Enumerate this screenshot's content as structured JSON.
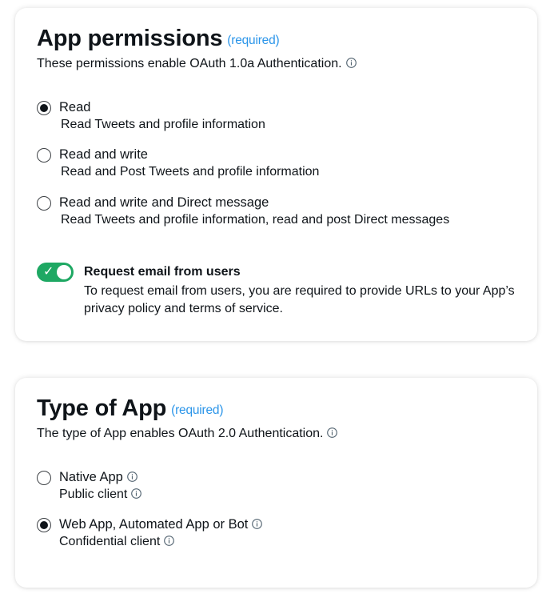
{
  "permissions": {
    "title": "App permissions",
    "required": "(required)",
    "subtitle": "These permissions enable OAuth 1.0a Authentication.",
    "options": [
      {
        "label": "Read",
        "description": "Read Tweets and profile information",
        "selected": true
      },
      {
        "label": "Read and write",
        "description": "Read and Post Tweets and profile information",
        "selected": false
      },
      {
        "label": "Read and write and Direct message",
        "description": "Read Tweets and profile information, read and post Direct messages",
        "selected": false
      }
    ],
    "email_toggle": {
      "label": "Request email from users",
      "description": "To request email from users, you are required to provide URLs to your App’s privacy policy and terms of service.",
      "enabled": true,
      "check_glyph": "✓"
    }
  },
  "app_type": {
    "title": "Type of App",
    "required": "(required)",
    "subtitle": "The type of App enables OAuth 2.0 Authentication.",
    "options": [
      {
        "label": "Native App",
        "description": "Public client",
        "selected": false
      },
      {
        "label": "Web App, Automated App or Bot",
        "description": "Confidential client",
        "selected": true
      }
    ]
  },
  "colors": {
    "accent_link": "#2b95e9",
    "toggle_on": "#1ea863",
    "text": "#0f1419"
  },
  "icons": {
    "info": "info-circle-icon",
    "check": "checkmark-icon"
  }
}
